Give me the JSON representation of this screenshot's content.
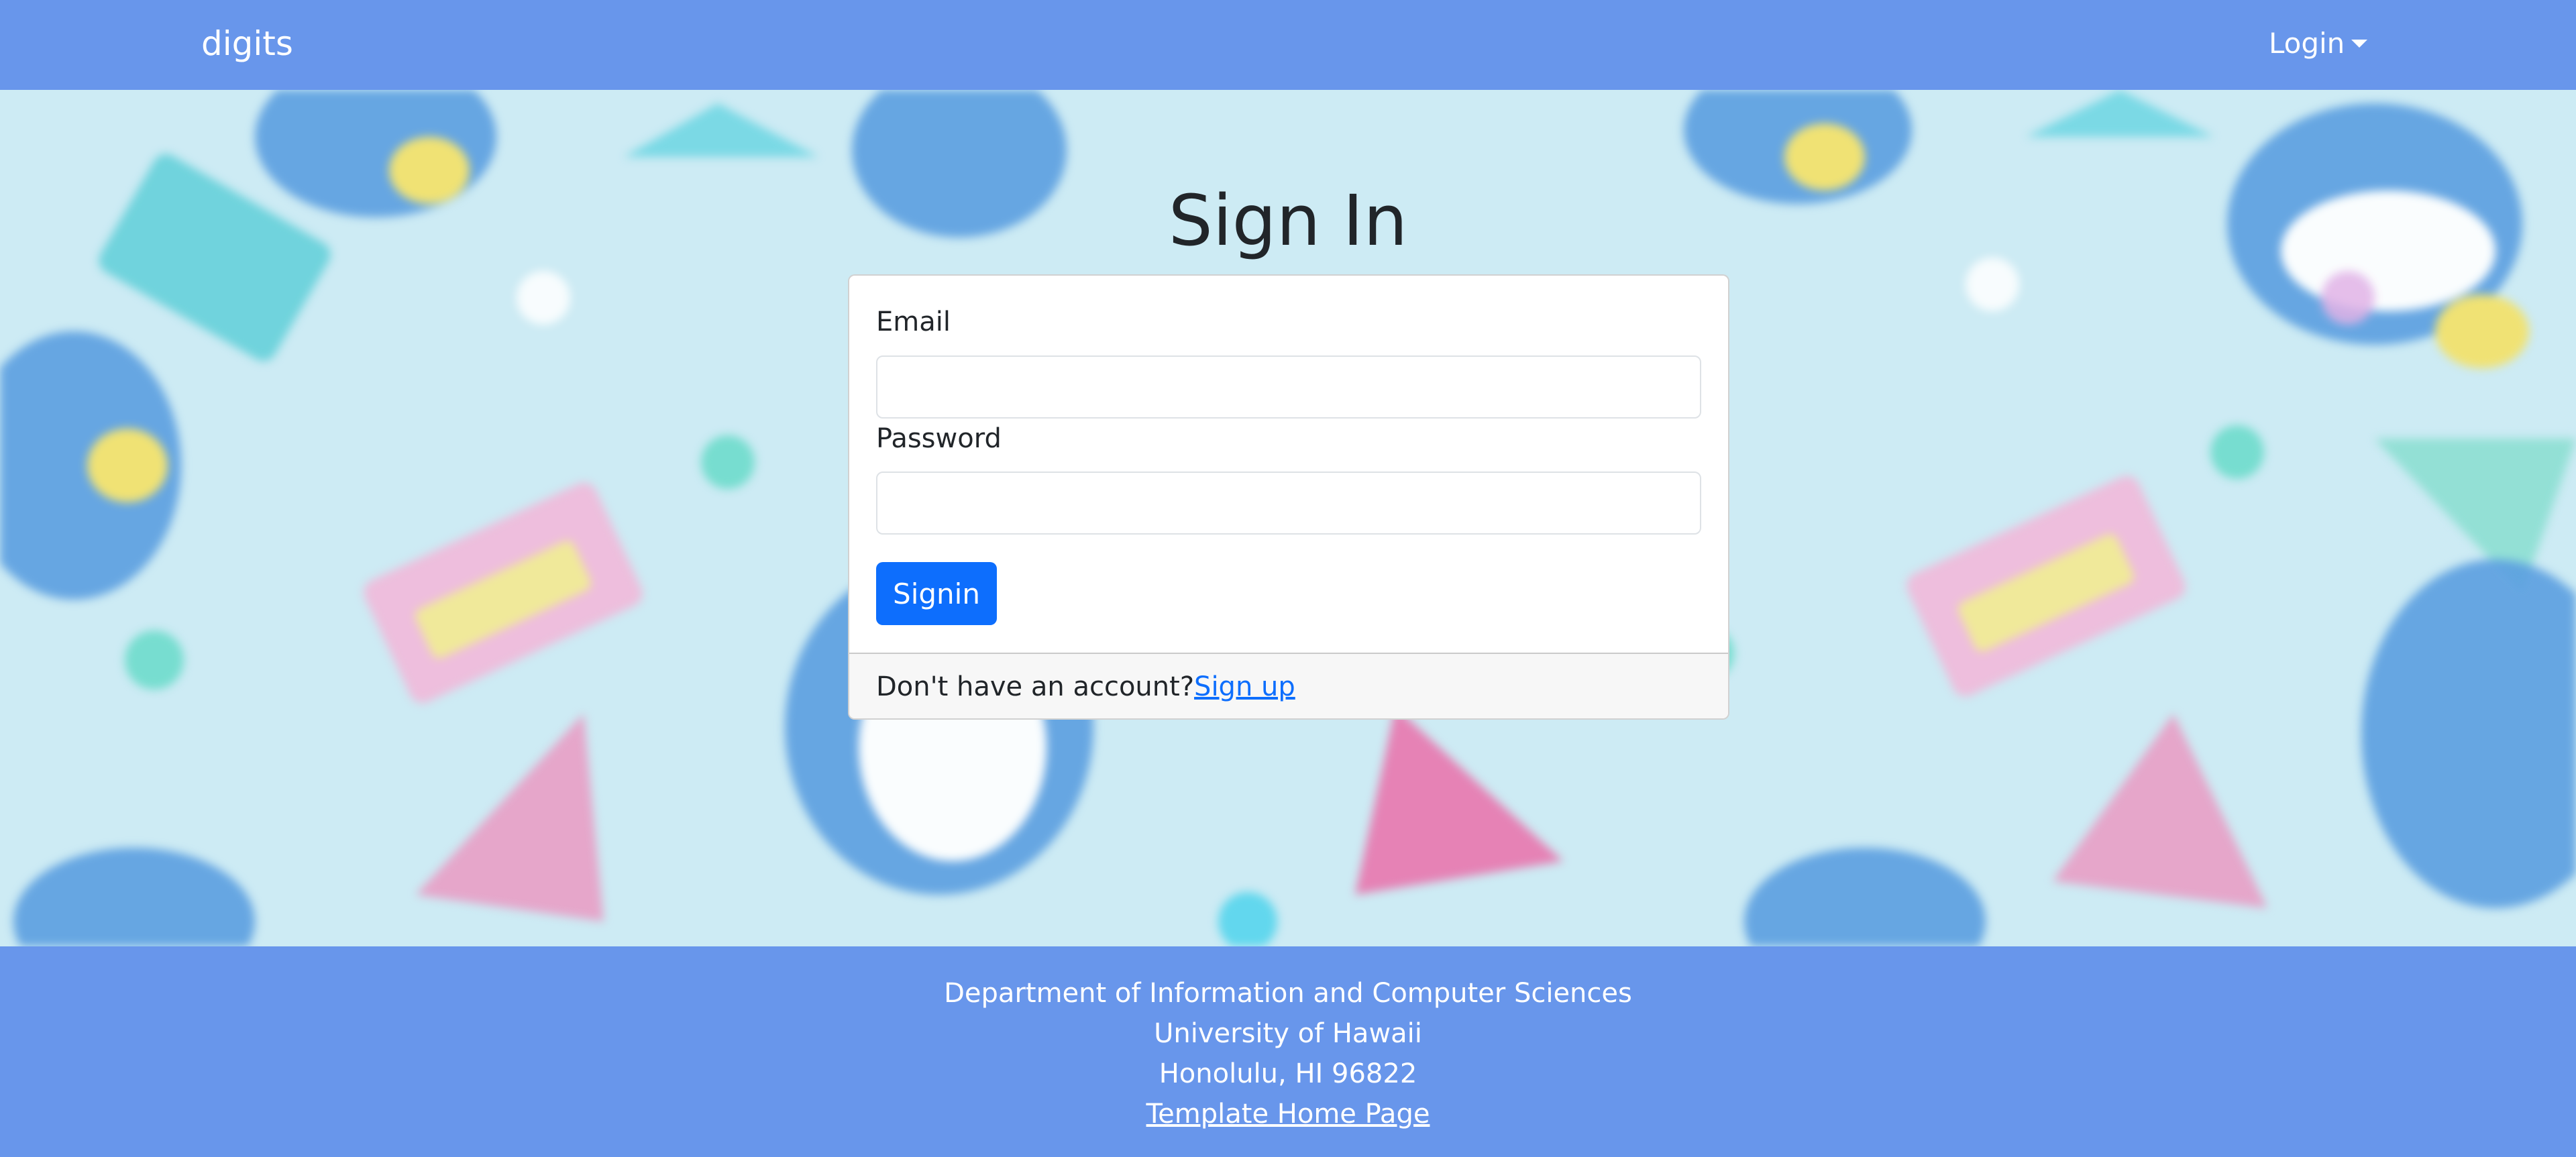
{
  "navbar": {
    "brand": "digits",
    "login_label": "Login"
  },
  "signin": {
    "title": "Sign In",
    "email_label": "Email",
    "email_value": "",
    "password_label": "Password",
    "password_value": "",
    "submit_label": "Signin",
    "no_account_text": "Don't have an account?",
    "signup_link": "Sign up"
  },
  "footer": {
    "line1": "Department of Information and Computer Sciences",
    "line2": "University of Hawaii",
    "line3": "Honolulu, HI 96822",
    "link": "Template Home Page"
  },
  "colors": {
    "navbar_bg": "#6896eb",
    "primary_button": "#0d6efd",
    "link": "#0d6efd",
    "background": "#cdebf4"
  },
  "icons": {
    "login_dropdown": "caret-down-icon"
  }
}
